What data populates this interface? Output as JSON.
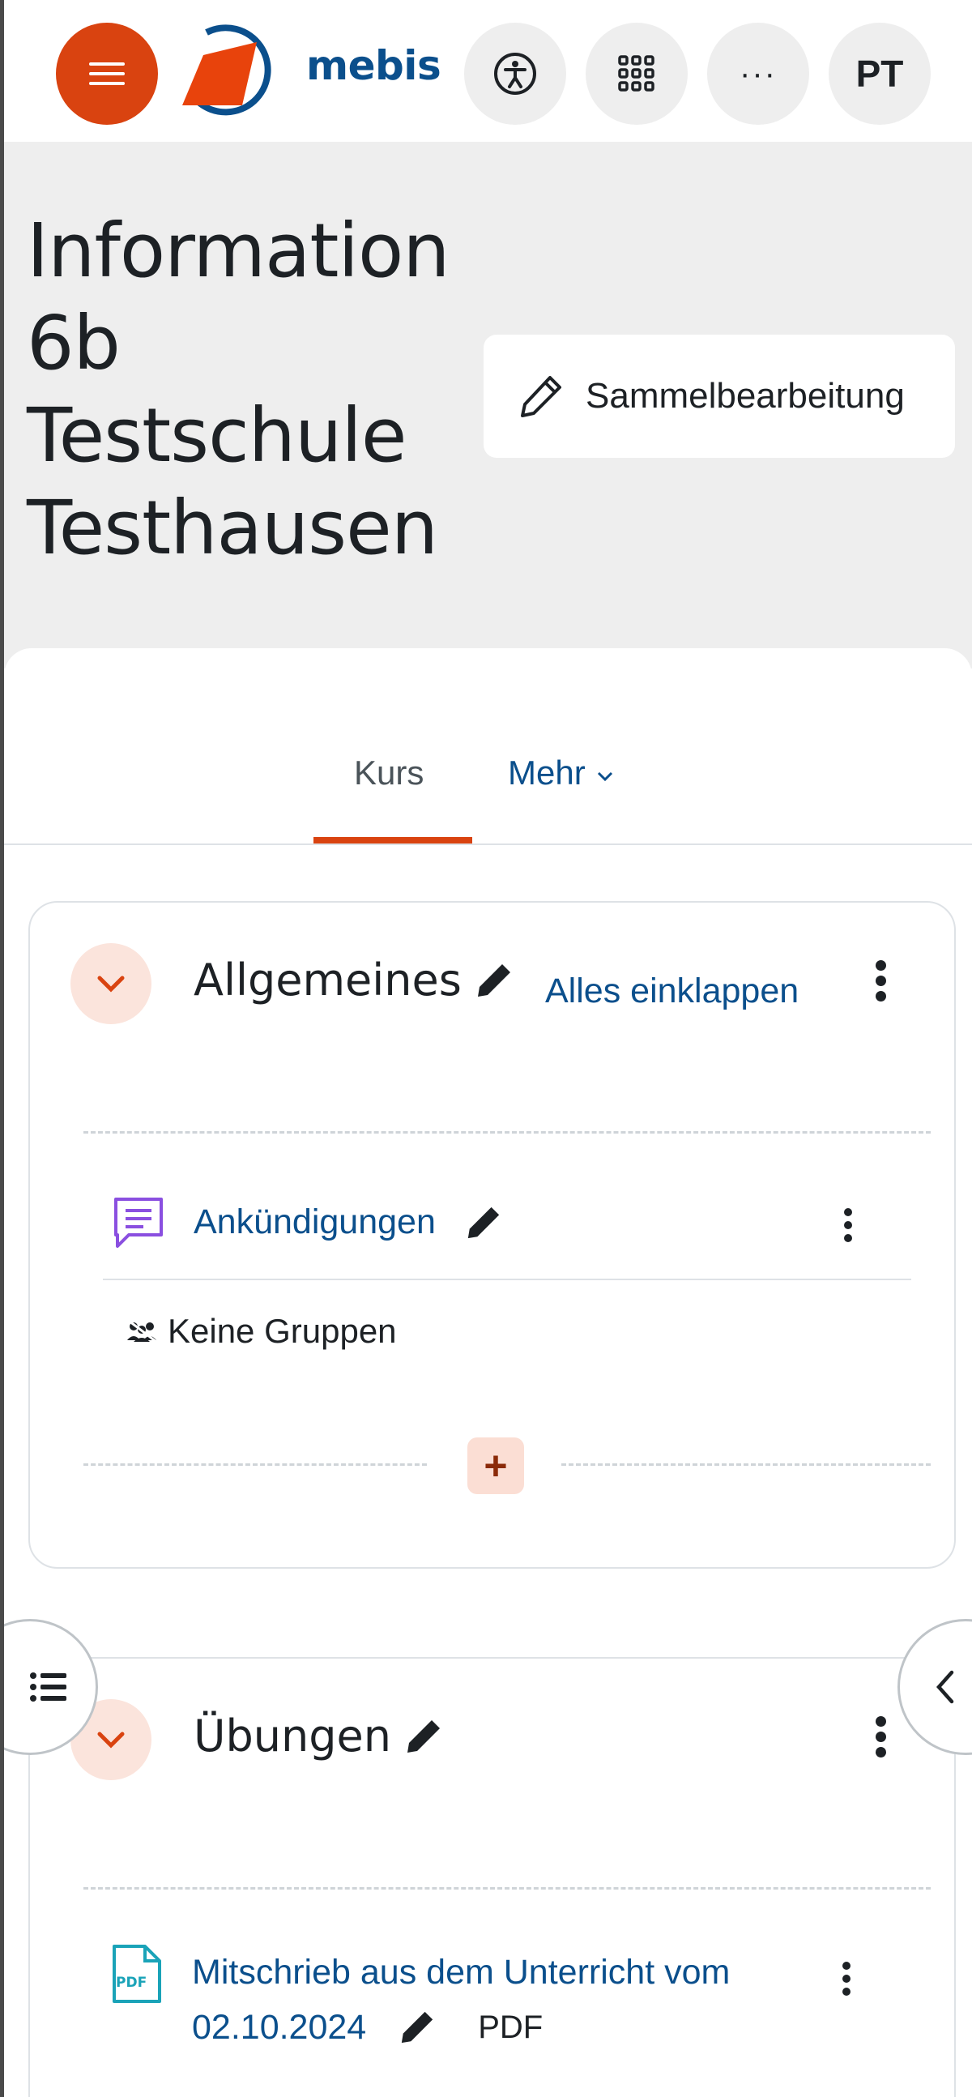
{
  "navbar": {
    "logo_text": "mebis",
    "avatar_initials": "PT",
    "more_label": "···",
    "icons": [
      "menu-icon",
      "accessibility-icon",
      "apps-grid-icon",
      "more-icon"
    ]
  },
  "header": {
    "title": "Information 6b Testschule Testhausen",
    "bulk_edit_label": "Sammelbearbeitung"
  },
  "tabs": [
    {
      "label": "Kurs",
      "active": true
    },
    {
      "label": "Mehr",
      "active": false
    }
  ],
  "sections": [
    {
      "title": "Allgemeines",
      "collapse_all_label": "Alles einklappen",
      "activities": [
        {
          "name": "Ankündigungen",
          "icon": "forum-icon",
          "groups_label": "Keine Gruppen"
        }
      ],
      "add_label": "+"
    },
    {
      "title": "Übungen",
      "resources": [
        {
          "name_line1": "Mitschrieb aus dem Unterricht vom",
          "name_line2": "02.10.2024",
          "type": "PDF",
          "icon_label": "PDF"
        }
      ]
    }
  ],
  "colors": {
    "accent": "#d94310",
    "link": "#0b4f8c",
    "header_bg": "#eeeeee",
    "toggle_bg": "#fbe4dc",
    "forum_icon": "#8a4fe0",
    "pdf_icon": "#1aa3b8"
  }
}
